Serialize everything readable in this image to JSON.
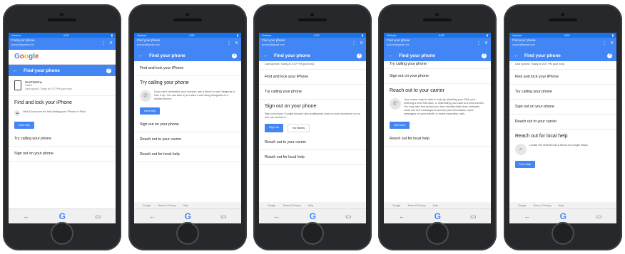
{
  "common": {
    "status_carrier": "Verizon",
    "status_time": "4:20",
    "status_battery": "▮",
    "app_title": "Find your phone",
    "app_subtitle": "account@gmail.com",
    "more_icon": "⋮",
    "close_icon": "✕",
    "header_title": "Find your phone",
    "back_icon": "←",
    "help_icon": "?",
    "footer_google": "Google",
    "footer_terms": "Terms & Privacy",
    "footer_help": "Help",
    "nav_back": "←",
    "nav_google": "G",
    "nav_tabs": "▭"
  },
  "phone1": {
    "google_logo": [
      "G",
      "o",
      "o",
      "g",
      "l",
      "e"
    ],
    "device_name": "OnePlusOne",
    "device_status": "Online",
    "device_last": "Last synced: Today at 3:37 PM (just now)",
    "section": "Find and lock your iPhone",
    "desc": "Visit iCloud.com for help finding your iPhone or iPad.",
    "btn": "Next step",
    "row1": "Try calling your phone",
    "row2": "Sign out on your phone"
  },
  "phone2": {
    "row1": "Find and lock your iPhone",
    "section": "Try calling your phone",
    "desc": "If you can't remember your number, ask a friend or use Hangouts to look it up. You can also try to make a call using Hangouts or a similar service.",
    "btn": "Next step",
    "row2": "Sign out on your phone",
    "row3": "Reach out to your carrier",
    "row4": "Reach out for local help"
  },
  "phone3": {
    "top": "Last synced: Today at 3:37 PM (just now)",
    "row1": "Find and lock your iPhone",
    "row2": "Try calling your phone",
    "section": "Sign out on your phone",
    "desc": "Sign out of your Google Account (kyl.and@gmail.com) on your lost phone so no one can access it.",
    "btn": "Sign out",
    "btn2": "No thanks",
    "row3": "Reach out to your carrier",
    "row4": "Reach out for local help"
  },
  "phone4": {
    "top": "Try calling your phone",
    "row1": "Sign out on your phone",
    "section": "Reach out to your carrier",
    "desc": "Your carrier may be able to help by disabling your SIM card, ordering a new SIM card, or redirecting your calls to a new number. You may also find protect you from identity theft since criminals could use text messages to access your information; send messages on your behalf, or make expensive calls.",
    "btn": "Next step",
    "row2": "Reach out for local help"
  },
  "phone5": {
    "top": "Last synced: Today at 3:37 PM (just now)",
    "row1": "Find and lock your iPhone",
    "row2": "Try calling your phone",
    "row3": "Sign out on your phone",
    "row4": "Reach out to your carrier",
    "section": "Reach out for local help",
    "desc": "Locate the nearest lost & found on Google Maps.",
    "btn": "Next step"
  }
}
